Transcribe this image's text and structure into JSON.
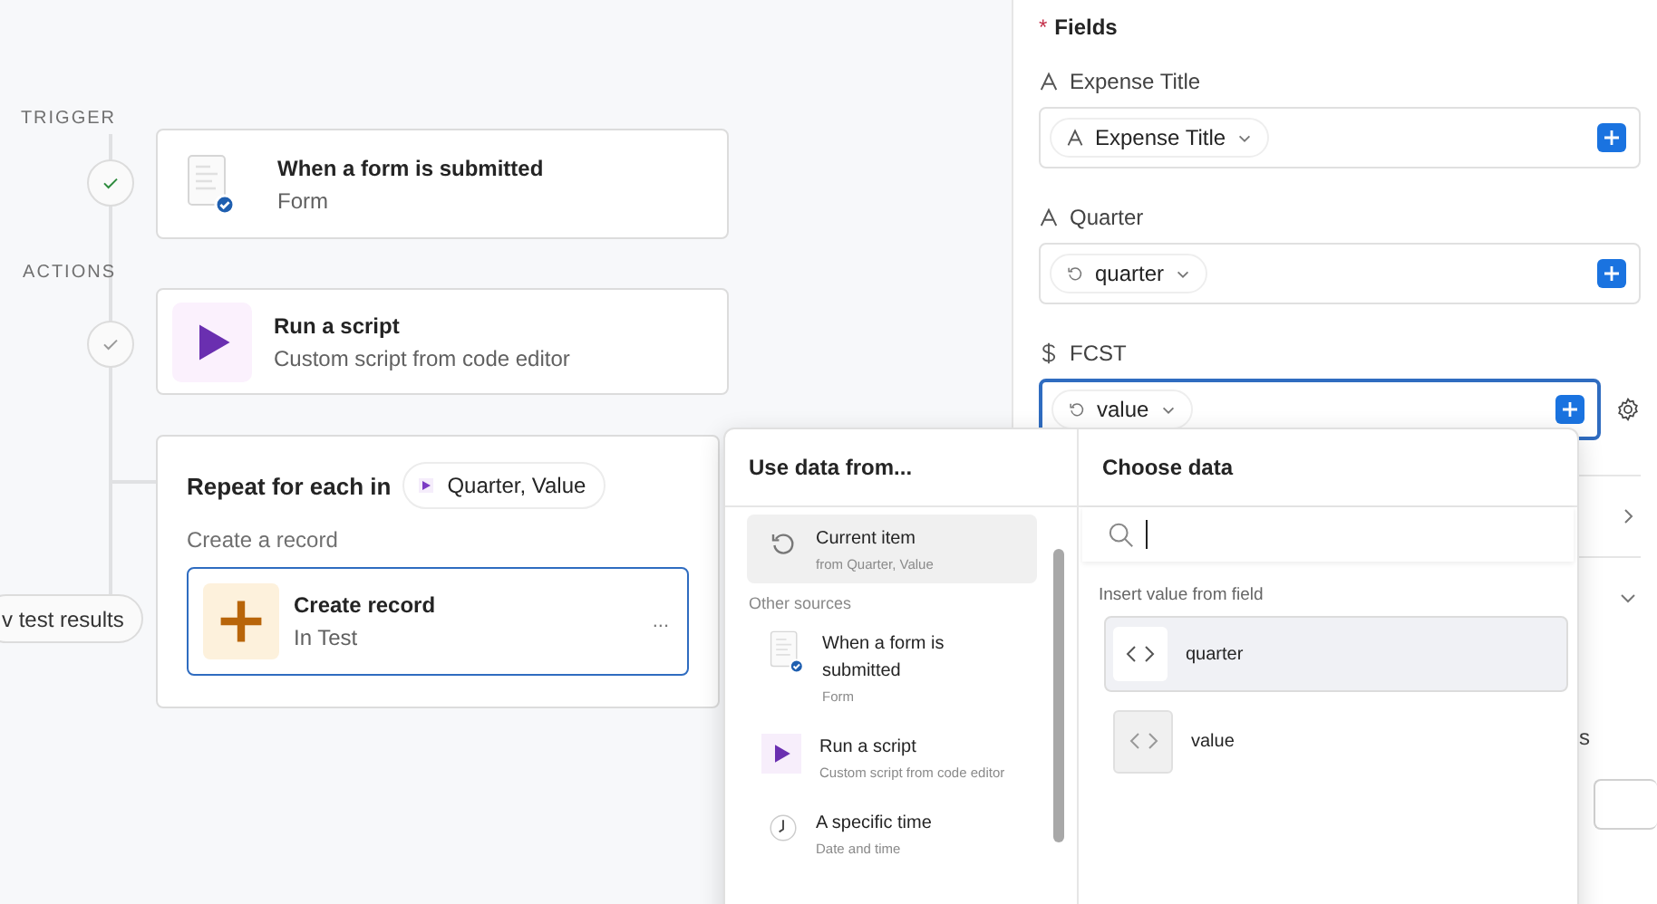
{
  "canvas": {
    "sections": [
      {
        "label": "TRIGGER"
      },
      {
        "label": "ACTIONS"
      }
    ],
    "steps": [
      {
        "kind": "form",
        "title": "When a form is submitted",
        "subtitle": "Form",
        "succeeded": true
      },
      {
        "kind": "script",
        "title": "Run a script",
        "subtitle": "Custom script from code editor",
        "succeeded": false
      }
    ],
    "loop": {
      "title": "Repeat for each in",
      "chip": "Quarter, Value",
      "subtitle": "Create a record",
      "action": {
        "title": "Create record",
        "subtitle": "In Test",
        "menu": "..."
      }
    },
    "test_results_button": "v test results"
  },
  "panel": {
    "required_mark": "*",
    "heading": "Fields",
    "fields": [
      {
        "kind": "text",
        "label": "Expense Title",
        "token": {
          "kind": "text",
          "label": "Expense Title"
        },
        "focused": false
      },
      {
        "kind": "text",
        "label": "Quarter",
        "token": {
          "kind": "loop",
          "label": "quarter"
        },
        "focused": false
      },
      {
        "kind": "currency",
        "label": "FCST",
        "token": {
          "kind": "loop",
          "label": "value"
        },
        "focused": true
      }
    ],
    "partial_text": "s"
  },
  "popup": {
    "sources_title": "Use data from...",
    "current": [
      {
        "kind": "loop",
        "title": "Current item",
        "subtitle": "from Quarter, Value",
        "selected": true
      }
    ],
    "other_sources": {
      "label": "Other sources",
      "items": [
        {
          "kind": "form",
          "title": "When a form is submitted",
          "subtitle": "Form",
          "selected": false
        },
        {
          "kind": "script",
          "title": "Run a script",
          "subtitle": "Custom script from code editor",
          "selected": false
        },
        {
          "kind": "time",
          "title": "A specific time",
          "subtitle": "Date and time",
          "selected": false
        }
      ]
    },
    "choose_title": "Choose data",
    "insert_label": "Insert value from field",
    "fields": [
      {
        "name": "quarter",
        "selected": true
      },
      {
        "name": "value",
        "selected": false
      }
    ]
  }
}
